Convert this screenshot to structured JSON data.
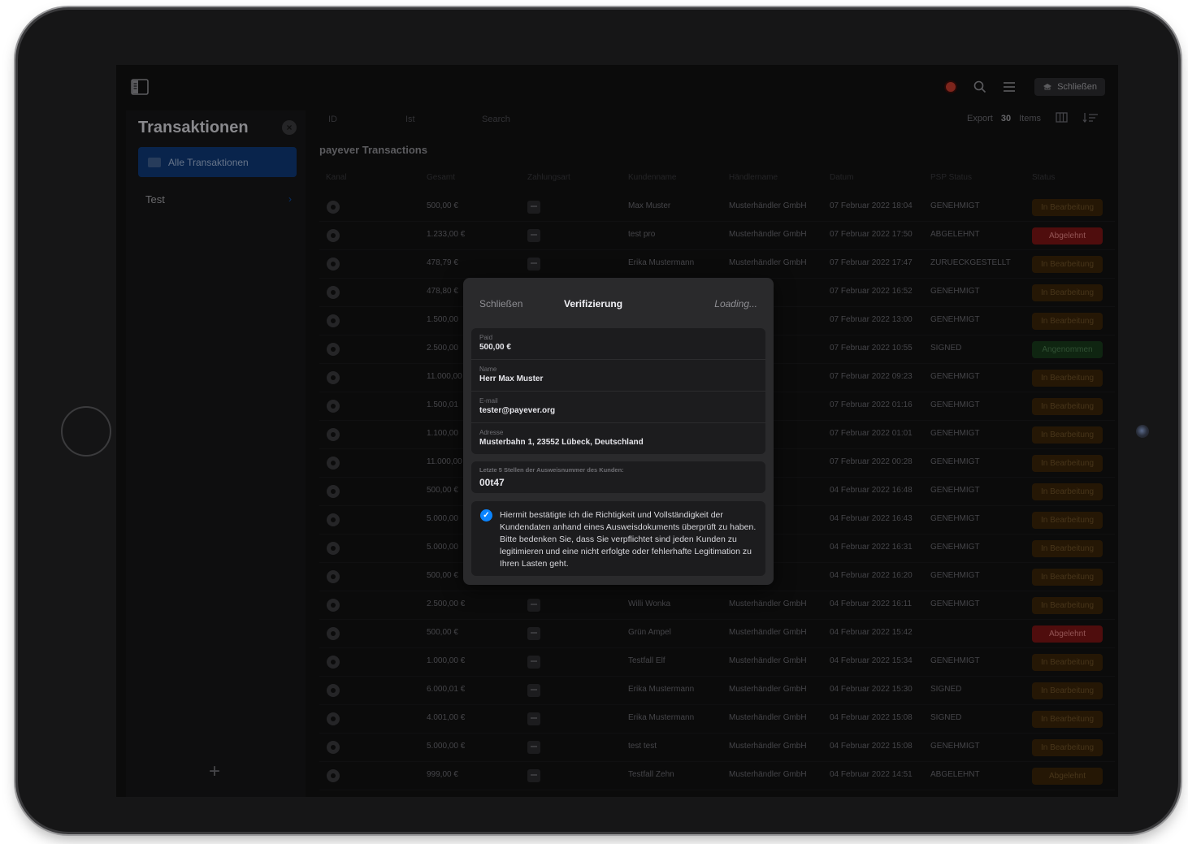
{
  "sidebar": {
    "title": "Transaktionen",
    "active_item": "Alle Transaktionen",
    "group_label": "Test",
    "add_label": "+"
  },
  "topbar": {
    "close_label": "Schließen"
  },
  "filters": {
    "id_placeholder": "ID",
    "ist_placeholder": "Ist",
    "search_placeholder": "Search",
    "export_label": "Export",
    "items_count": "30",
    "items_label": "Items"
  },
  "section_title": "payever Transactions",
  "table": {
    "columns": [
      "Kanal",
      "Gesamt",
      "Zahlungsart",
      "Kundenname",
      "Händlername",
      "Datum",
      "PSP Status",
      "Status"
    ],
    "rows": [
      {
        "total": "500,00 €",
        "customer": "Max Muster",
        "merchant": "Musterhändler GmbH",
        "date": "07 Februar 2022 18:04",
        "psp": "GENEHMIGT",
        "status": "In Bearbeitung",
        "kind": "pending"
      },
      {
        "total": "1.233,00 €",
        "customer": "test pro",
        "merchant": "Musterhändler GmbH",
        "date": "07 Februar 2022 17:50",
        "psp": "ABGELEHNT",
        "status": "Abgelehnt",
        "kind": "declined"
      },
      {
        "total": "478,79 €",
        "customer": "Erika Mustermann",
        "merchant": "Musterhändler GmbH",
        "date": "07 Februar 2022 17:47",
        "psp": "ZURUECKGESTELLT",
        "status": "In Bearbeitung",
        "kind": "pending"
      },
      {
        "total": "478,80 €",
        "customer": "",
        "merchant": "ler GmbH",
        "date": "07 Februar 2022 16:52",
        "psp": "GENEHMIGT",
        "status": "In Bearbeitung",
        "kind": "pending"
      },
      {
        "total": "1.500,00",
        "customer": "",
        "merchant": "ler GmbH",
        "date": "07 Februar 2022 13:00",
        "psp": "GENEHMIGT",
        "status": "In Bearbeitung",
        "kind": "pending"
      },
      {
        "total": "2.500,00",
        "customer": "",
        "merchant": "ler GmbH",
        "date": "07 Februar 2022 10:55",
        "psp": "SIGNED",
        "status": "Angenommen",
        "kind": "signed"
      },
      {
        "total": "11.000,00",
        "customer": "",
        "merchant": "ler GmbH",
        "date": "07 Februar 2022 09:23",
        "psp": "GENEHMIGT",
        "status": "In Bearbeitung",
        "kind": "pending"
      },
      {
        "total": "1.500,01",
        "customer": "",
        "merchant": "ler GmbH",
        "date": "07 Februar 2022 01:16",
        "psp": "GENEHMIGT",
        "status": "In Bearbeitung",
        "kind": "pending"
      },
      {
        "total": "1.100,00",
        "customer": "",
        "merchant": "ler GmbH",
        "date": "07 Februar 2022 01:01",
        "psp": "GENEHMIGT",
        "status": "In Bearbeitung",
        "kind": "pending"
      },
      {
        "total": "11.000,00",
        "customer": "",
        "merchant": "ler GmbH",
        "date": "07 Februar 2022 00:28",
        "psp": "GENEHMIGT",
        "status": "In Bearbeitung",
        "kind": "pending"
      },
      {
        "total": "500,00 €",
        "customer": "",
        "merchant": "ler GmbH",
        "date": "04 Februar 2022 16:48",
        "psp": "GENEHMIGT",
        "status": "In Bearbeitung",
        "kind": "pending"
      },
      {
        "total": "5.000,00",
        "customer": "",
        "merchant": "ler GmbH",
        "date": "04 Februar 2022 16:43",
        "psp": "GENEHMIGT",
        "status": "In Bearbeitung",
        "kind": "pending"
      },
      {
        "total": "5.000,00",
        "customer": "",
        "merchant": "ler GmbH",
        "date": "04 Februar 2022 16:31",
        "psp": "GENEHMIGT",
        "status": "In Bearbeitung",
        "kind": "pending"
      },
      {
        "total": "500,00 €",
        "customer": "",
        "merchant": "ler GmbH",
        "date": "04 Februar 2022 16:20",
        "psp": "GENEHMIGT",
        "status": "In Bearbeitung",
        "kind": "pending"
      },
      {
        "total": "2.500,00 €",
        "customer": "Willi Wonka",
        "merchant": "Musterhändler GmbH",
        "date": "04 Februar 2022 16:11",
        "psp": "GENEHMIGT",
        "status": "In Bearbeitung",
        "kind": "pending"
      },
      {
        "total": "500,00 €",
        "customer": "Grün Ampel",
        "merchant": "Musterhändler GmbH",
        "date": "04 Februar 2022 15:42",
        "psp": "",
        "status": "Abgelehnt",
        "kind": "declined"
      },
      {
        "total": "1.000,00 €",
        "customer": "Testfall Elf",
        "merchant": "Musterhändler GmbH",
        "date": "04 Februar 2022 15:34",
        "psp": "GENEHMIGT",
        "status": "In Bearbeitung",
        "kind": "pending"
      },
      {
        "total": "6.000,01 €",
        "customer": "Erika Mustermann",
        "merchant": "Musterhändler GmbH",
        "date": "04 Februar 2022 15:30",
        "psp": "SIGNED",
        "status": "In Bearbeitung",
        "kind": "pending"
      },
      {
        "total": "4.001,00 €",
        "customer": "Erika Mustermann",
        "merchant": "Musterhändler GmbH",
        "date": "04 Februar 2022 15:08",
        "psp": "SIGNED",
        "status": "In Bearbeitung",
        "kind": "pending"
      },
      {
        "total": "5.000,00 €",
        "customer": "test test",
        "merchant": "Musterhändler GmbH",
        "date": "04 Februar 2022 15:08",
        "psp": "GENEHMIGT",
        "status": "In Bearbeitung",
        "kind": "pending"
      },
      {
        "total": "999,00 €",
        "customer": "Testfall Zehn",
        "merchant": "Musterhändler GmbH",
        "date": "04 Februar 2022 14:51",
        "psp": "ABGELEHNT",
        "status": "Abgelehnt",
        "kind": "pending"
      }
    ]
  },
  "modal": {
    "close_label": "Schließen",
    "title": "Verifizierung",
    "loading_label": "Loading...",
    "fields": [
      {
        "label": "Paid",
        "value": "500,00 €"
      },
      {
        "label": "Name",
        "value": "Herr Max Muster"
      },
      {
        "label": "E-mail",
        "value": "tester@payever.org"
      },
      {
        "label": "Adresse",
        "value": "Musterbahn 1, 23552 Lübeck, Deutschland"
      }
    ],
    "id_label": "Letzte 5 Stellen der Ausweisnummer des Kunden:",
    "id_value": "00t47",
    "confirm_text": "Hiermit bestätigte ich die Richtigkeit und Vollständigkeit der Kundendaten anhand eines Ausweisdokuments überprüft zu haben. Bitte bedenken Sie, dass Sie verpflichtet sind jeden Kunden zu legitimieren und eine nicht erfolgte oder fehlerhafte Legitimation zu Ihren Lasten geht."
  },
  "colors": {
    "accent": "#0a84ff",
    "active_nav": "#0e3875",
    "declined": "#7a1414",
    "pending": "#3a2408",
    "signed": "#173a1b"
  }
}
